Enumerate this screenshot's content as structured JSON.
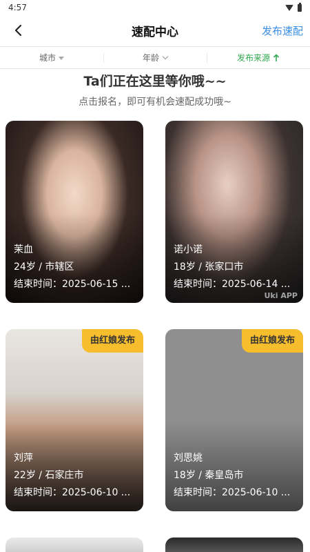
{
  "status_bar": {
    "time": "4:57"
  },
  "nav": {
    "title": "速配中心",
    "action_label": "发布速配"
  },
  "filters": [
    {
      "label": "城市"
    },
    {
      "label": "年龄"
    },
    {
      "label": "发布来源"
    }
  ],
  "heading": "Ta们正在这里等你哦~~",
  "subheading": "点击报名，即可有机会速配成功哦~",
  "cards": [
    {
      "name": "茉血",
      "age_city": "24岁 / 市辖区",
      "end_time": "结束时间：2025-06-15 ...",
      "badge": "",
      "watermark": ""
    },
    {
      "name": "诺小诺",
      "age_city": "18岁 / 张家口市",
      "end_time": "结束时间：2025-06-14 ...",
      "badge": "",
      "watermark": "Uki APP"
    },
    {
      "name": "刘萍",
      "age_city": "22岁 / 石家庄市",
      "end_time": "结束时间：2025-06-10 ...",
      "badge": "由红娘发布",
      "watermark": ""
    },
    {
      "name": "刘思姚",
      "age_city": "18岁 / 秦皇岛市",
      "end_time": "结束时间：2025-06-10 ...",
      "badge": "由红娘发布",
      "watermark": ""
    }
  ]
}
